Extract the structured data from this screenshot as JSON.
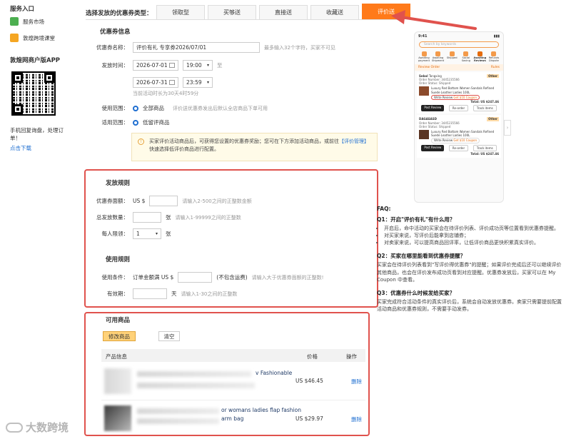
{
  "sidebar": {
    "service_entry": "服务入口",
    "items": [
      {
        "label": "服务市场",
        "icon": "puzzle-icon"
      },
      {
        "label": "敦煌跨境课堂",
        "icon": "classroom-icon"
      }
    ],
    "app_title": "敦煌网商户版APP",
    "app_desc": "手机回复询盘，处理订单！",
    "download": "点击下载"
  },
  "tabs": {
    "label": "选择发放的优惠券类型：",
    "items": [
      "领取型",
      "买够送",
      "直接送",
      "收藏送",
      "评价送"
    ],
    "active": "评价送"
  },
  "coupon_info": {
    "heading": "优惠券信息",
    "name_label": "优惠券名称：",
    "name_value": "评价有礼 专享券2026/07/01",
    "name_hint": "最多输入32个字符，买家不可见",
    "time_label": "发放时间：",
    "start_date": "2026-07-01",
    "start_time": "19:00",
    "to": "至",
    "end_date": "2026-07-31",
    "end_time": "23:59",
    "duration": "当前活动时长为30天4时59分",
    "scope_label": "使用范围：",
    "scope_value": "全部商品",
    "scope_hint": "评价送优惠券发出后默认全店商品下单可用",
    "apply_label": "适用范围：",
    "apply_value": "低留评商品",
    "notice_text": "买家评价活动商品后，可获得您设置的优惠券奖励；您可在下方添加活动商品，或前往",
    "notice_link": "【评价管理】",
    "notice_tail": "快速选择低评价商品进行配置。"
  },
  "issue_rules": {
    "heading": "发放规则",
    "face_label": "优惠券面额：",
    "currency": "US $",
    "face_hint": "请输入2-500之间的正整数金额",
    "total_label": "总发放数量：",
    "total_unit": "张",
    "total_hint": "请输入1-99999之间的正整数",
    "limit_label": "每人限领：",
    "limit_value": "1",
    "limit_unit": "张"
  },
  "use_rules": {
    "heading": "使用规则",
    "cond_label": "使用条件：",
    "cond_prefix": "订单金额满 US $",
    "cond_note": "(不包含运费)",
    "cond_hint": "请输入大于优惠券面额的正整数!",
    "valid_label": "有效期：",
    "valid_unit": "天",
    "valid_hint": "请输入1-30之间的正整数"
  },
  "products": {
    "heading": "可用商品",
    "modify_btn": "修改商品",
    "clear_btn": "清空",
    "col_info": "产品信息",
    "col_price": "价格",
    "col_action": "操作",
    "rows": [
      {
        "title": "v Fashionable",
        "price": "US $46.45",
        "action": "删除"
      },
      {
        "title": "or womans ladies flap fashion",
        "title2": "arm bag",
        "price": "US $29.97",
        "action": "删除"
      }
    ]
  },
  "phone": {
    "time": "9:41",
    "search": "Search by keywords",
    "nav": [
      "Awaiting payment",
      "Awaiting Shipment",
      "Shipped",
      "Social Saving",
      "Awaiting Reviews",
      "Refunds Dispute"
    ],
    "review_order": "Review Order",
    "rules": "Rules",
    "order1": {
      "store": "Sebol",
      "store_sub": "Tongxing",
      "other": "Other",
      "number": "Order Number: 3445235566",
      "status": "Order Status: Shipped",
      "product": "Luxury Red Bottom Women Sandals Refined Suede Leather Ladies 100L",
      "write_review": "Write Review",
      "get_coupon": "Get $10 Coupon",
      "total": "Total: US $247.46",
      "buttons": [
        "Post Review",
        "Re-order",
        "Track items"
      ]
    },
    "order2": {
      "store": "DAGASASD",
      "other": "Other",
      "number": "Order Number: 3445235566",
      "status": "Order Status: Shipped",
      "product": "Luxury Red Bottom Women Sandals Refined Suede Leather Ladies 100L",
      "write_review": "Write Review",
      "get_coupon": "Get $10 Coupon",
      "buttons": [
        "Post Review",
        "Re-order",
        "Track items"
      ],
      "total": "Total: US $247.46"
    }
  },
  "faq": {
    "title": "FAQ:",
    "q1": "Q1：开启\"评价有礼\"有什么用？",
    "q1_points": [
      "开启后，命中活动的买家会在待评价列表、评价成功页等位置看到优惠券提醒。",
      "对买家来说，写评价后能拿到店铺券；",
      "对卖家来说，可以提高商品回评率，让低评价商品更快积累真实评价。"
    ],
    "q2": "Q2：买家在哪里能看到优惠券提醒？",
    "q2_text": "买家会在待评价列表看到\"写评价得优惠券\"的提醒；如果评价完成后还可以继续评价其他商品，也会在评价发布成功页看到对应提醒。优惠券发放后，买家可以在 My Coupon 中查看。",
    "q3": "Q3：优惠券什么时候发给买家？",
    "q3_text": "买家完成符合活动条件的真实评价后，系统会自动发放优惠券。卖家只需要提前配置活动商品和优惠券规则，不需要手动发券。"
  },
  "watermark": "大数跨境",
  "colors": {
    "accent": "#ff7a1a",
    "link": "#1f6fd1",
    "highlight": "#e0524d"
  }
}
